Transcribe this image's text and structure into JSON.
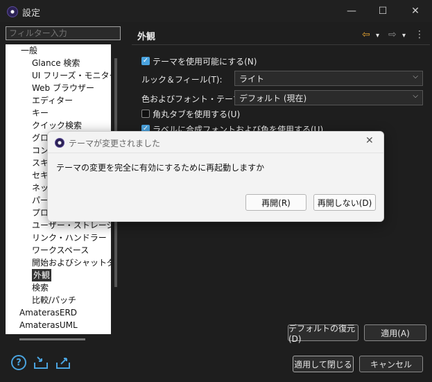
{
  "window": {
    "title": "設定",
    "minimize_icon": "—",
    "maximize_icon": "☐",
    "close_icon": "✕"
  },
  "filter": {
    "placeholder": "フィルター入力"
  },
  "tree": {
    "items": [
      {
        "label": "一般",
        "level": 1
      },
      {
        "label": "Glance 検索",
        "level": 2
      },
      {
        "label": "UI フリーズ・モニター",
        "level": 2
      },
      {
        "label": "Web ブラウザー",
        "level": 2
      },
      {
        "label": "エディター",
        "level": 2
      },
      {
        "label": "キー",
        "level": 2
      },
      {
        "label": "クイック検索",
        "level": 2
      },
      {
        "label": "グロー",
        "level": 2
      },
      {
        "label": "コンテ",
        "level": 2
      },
      {
        "label": "スキ",
        "level": 2
      },
      {
        "label": "セキ",
        "level": 2
      },
      {
        "label": "ネット",
        "level": 2
      },
      {
        "label": "パース",
        "level": 2
      },
      {
        "label": "プロジ",
        "level": 2
      },
      {
        "label": "ユーザー・ストレージ・サー",
        "level": 2
      },
      {
        "label": "リンク・ハンドラー",
        "level": 2
      },
      {
        "label": "ワークスペース",
        "level": 2
      },
      {
        "label": "開始およびシャットダウン",
        "level": 2
      },
      {
        "label": "外観",
        "level": 2,
        "selected": true
      },
      {
        "label": "検索",
        "level": 2
      },
      {
        "label": "比較/パッチ",
        "level": 2
      },
      {
        "label": "AmaterasERD",
        "level": 0
      },
      {
        "label": "AmaterasUML",
        "level": 0
      }
    ]
  },
  "pane": {
    "title": "外観",
    "back_icon": "⇦",
    "forward_icon": "⇨",
    "dropdown_icon": "▾",
    "menu_icon": "⋮",
    "enable_theme": {
      "label": "テーマを使用可能にする(N)",
      "checked": true
    },
    "look_feel": {
      "label": "ルック＆フィール(T):",
      "value": "ライト"
    },
    "color_font": {
      "label": "色およびフォント・テーマ(C):",
      "value": "デフォルト (現在)"
    },
    "round_tabs": {
      "label": "角丸タブを使用する(U)",
      "checked": false
    },
    "label_fonts": {
      "label": "ラベルに合成フォントおよび色を使用する(U)",
      "checked": true
    },
    "restore_defaults": "デフォルトの復元(D)",
    "apply": "適用(A)"
  },
  "footer": {
    "help_icon": "?",
    "import_icon": "import-icon",
    "export_icon": "export-icon",
    "apply_close": "適用して閉じる",
    "cancel": "キャンセル"
  },
  "dialog": {
    "title": "テーマが変更されました",
    "message": "テーマの変更を完全に有効にするために再起動しますか",
    "restart": "再開(R)",
    "no_restart": "再開しない(D)",
    "close_icon": "✕"
  }
}
